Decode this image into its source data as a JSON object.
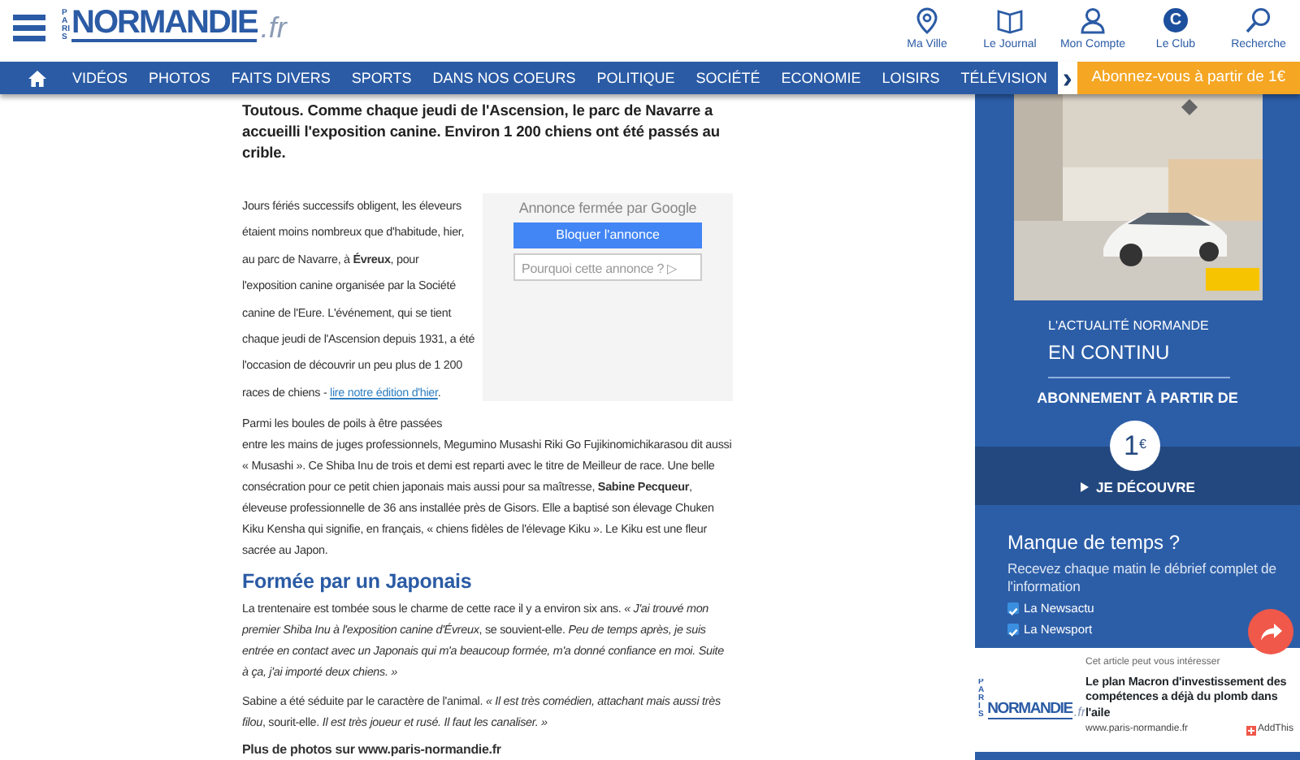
{
  "header": {
    "logo": {
      "small": "PARIS",
      "main": "NORMANDIE",
      "suffix": ".fr"
    },
    "shortcuts": [
      {
        "kind": "pin",
        "label": "Ma Ville"
      },
      {
        "kind": "book",
        "label": "Le Journal"
      },
      {
        "kind": "person",
        "label": "Mon Compte"
      },
      {
        "kind": "club",
        "label": "Le Club",
        "glyph": "C"
      },
      {
        "kind": "search",
        "label": "Recherche"
      }
    ]
  },
  "nav": {
    "items": [
      "VIDÉOS",
      "PHOTOS",
      "FAITS DIVERS",
      "SPORTS",
      "DANS NOS COEURS",
      "POLITIQUE",
      "SOCIÉTÉ",
      "ECONOMIE",
      "LOISIRS",
      "TÉLÉVISION"
    ],
    "more": "›",
    "subscribe": "Abonnez-vous à partir de 1€"
  },
  "article": {
    "lead": "Toutous. Comme chaque jeudi de l'Ascension, le parc de Navarre a accueilli l'exposition canine. Environ 1 200 chiens ont été passés au crible.",
    "intro": {
      "text": "Jours fériés successifs obligent, les éleveurs étaient moins nombreux que d'habitude, hier, au parc de Navarre, à **Évreux**, pour l'exposition canine organisée par la Société canine de l'Eure. L'événement, qui se tient chaque jeudi de l'Ascension depuis 1931, a été l'occasion de découvrir un peu plus de 1 200 races de chiens - ",
      "link": "lire notre édition d'hier",
      "after": "."
    },
    "closed_ad": {
      "title": "Annonce fermée par Google",
      "button": "Bloquer l'annonce",
      "why": "Pourquoi cette annonce ? ▷"
    },
    "blocks": [
      {
        "kind": "paragraph",
        "text": "Parmi les boules de poils à être passées\nentre les mains de juges professionnels, Megumino Musashi Riki Go Fujikinomichikarasou dit aussi « Musashi ». Ce Shiba Inu de trois et demi est reparti avec le titre de Meilleur de race. Une belle consécration pour ce petit chien japonais mais aussi pour sa maîtresse, **Sabine Pecqueur**, éleveuse professionnelle de 36 ans installée près de Gisors. Elle a baptisé son élevage Chuken Kiku Kensha qui signifie, en français, « chiens fidèles de l'élevage Kiku ». Le Kiku est une fleur sacrée au Japon."
      },
      {
        "kind": "heading",
        "text": "Formée par un Japonais"
      },
      {
        "kind": "paragraph",
        "text": "La trentenaire est tombée sous le charme de cette race il y a environ six ans. *« J'ai trouvé mon premier Shiba Inu à l'exposition canine d'Évreux*, se souvient-elle. *Peu de temps après, je suis entrée en contact avec un Japonais qui m'a beaucoup formée, m'a donné confiance en moi. Suite à ça, j'ai importé deux chiens. »*"
      },
      {
        "kind": "paragraph",
        "text": "Sabine a été séduite par le caractère de l'animal. *« Il est très comédien, attachant mais aussi très filou*, sourit-elle. *Il est très joueur et rusé. Il faut les canaliser. »*"
      },
      {
        "kind": "credit",
        "text": "Plus de photos sur www.paris-normandie.fr"
      }
    ]
  },
  "sidebar": {
    "promo": {
      "kicker": "L'ACTUALITÉ NORMANDE",
      "title": "EN CONTINU",
      "offer": "ABONNEMENT À PARTIR DE",
      "price": "1",
      "currency": "€",
      "cta": "JE DÉCOUVRE"
    },
    "newsletter": {
      "title": "Manque de temps ?",
      "text": "Recevez chaque matin le débrief complet de l'information",
      "options": [
        {
          "label": "La Newsactu",
          "checked": true
        },
        {
          "label": "La Newsport",
          "checked": true
        }
      ]
    },
    "suggest": {
      "logo": {
        "small": "PARIS",
        "main": "NORMANDIE",
        "suffix": ".fr"
      },
      "kicker": "Cet article peut vous intéresser",
      "title": "Le plan Macron d'investissement des compétences a déjà du plomb dans l'aile",
      "url": "www.paris-normandie.fr",
      "addthis": "AddThis"
    }
  }
}
